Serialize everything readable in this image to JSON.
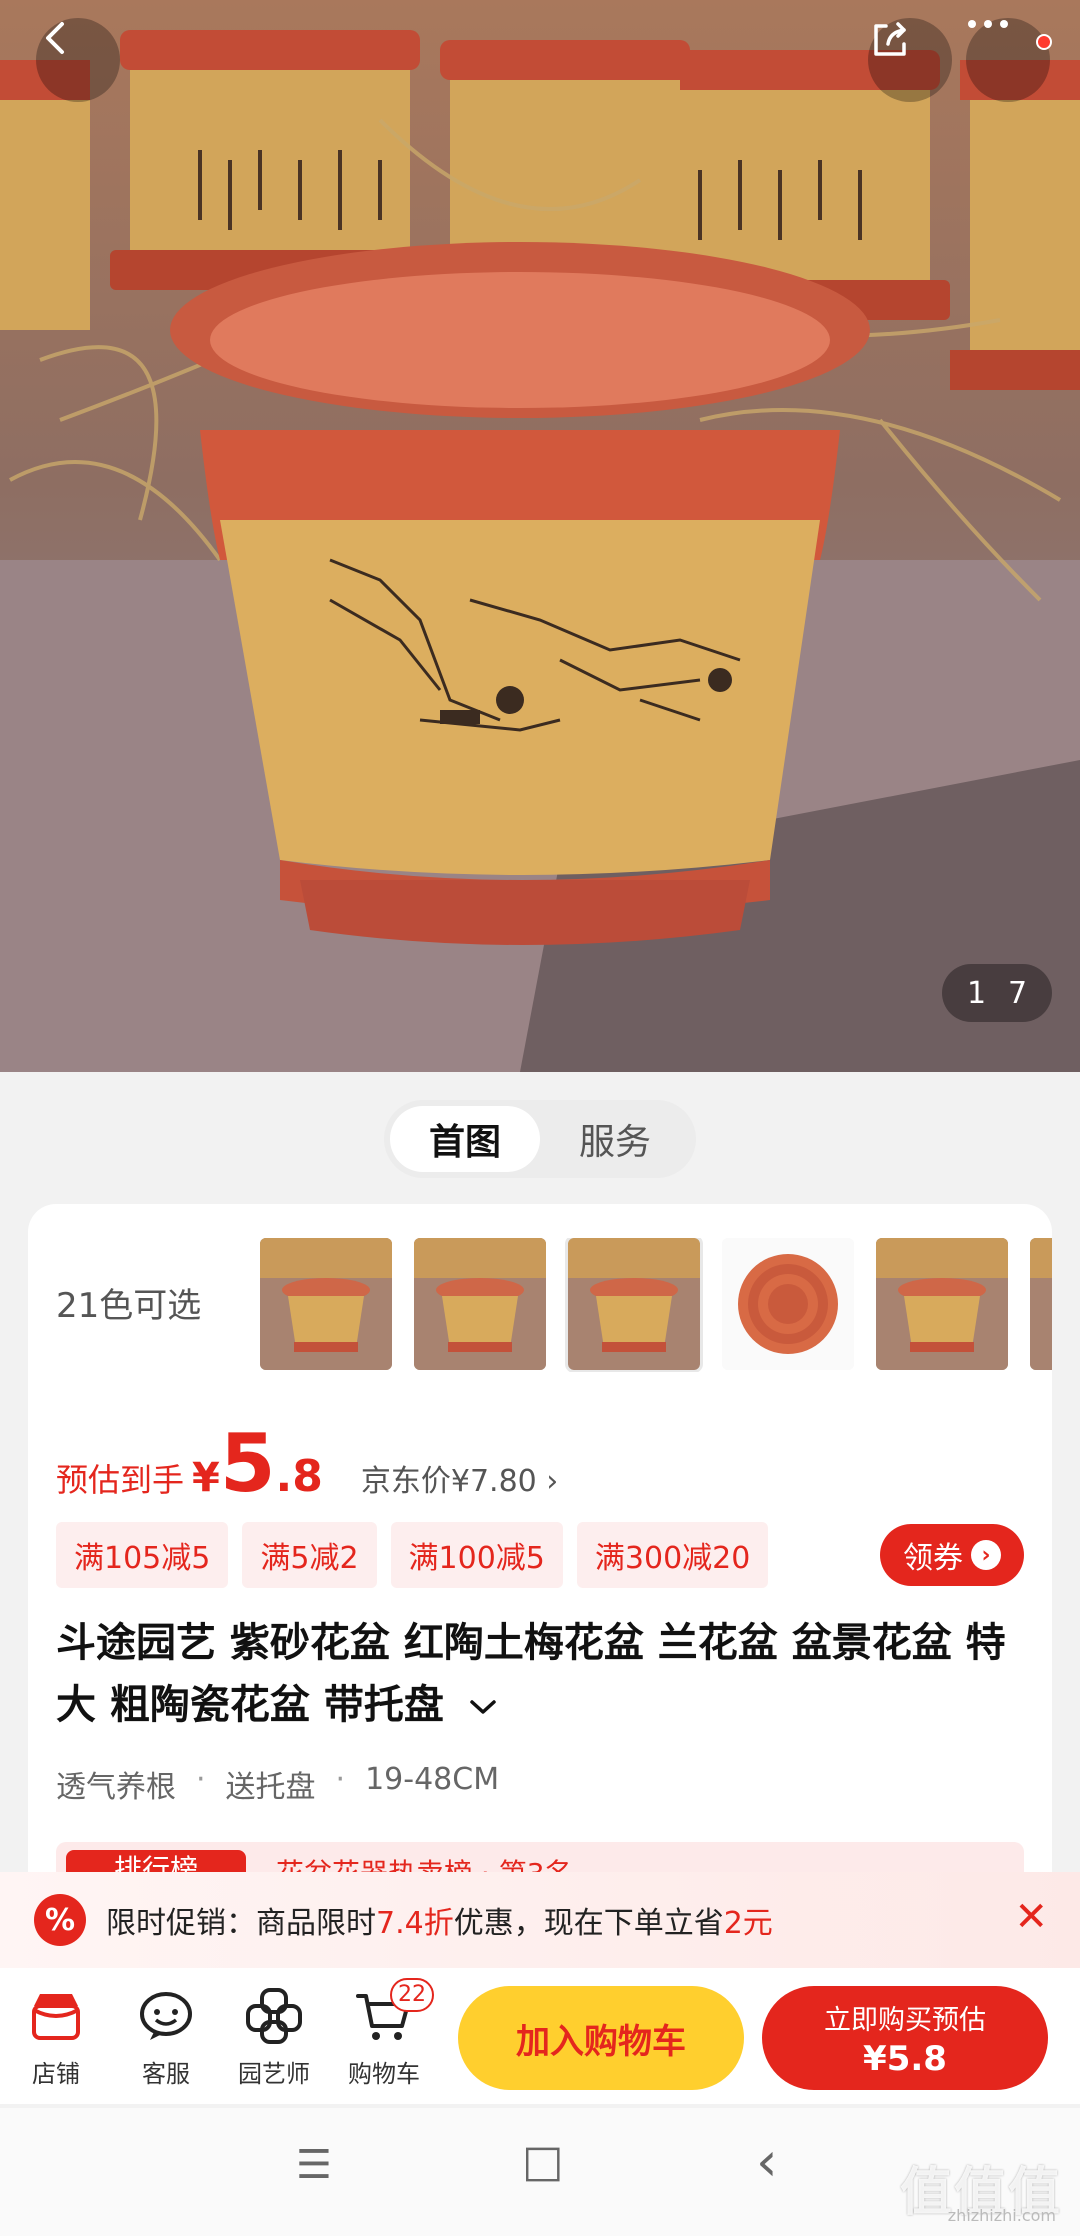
{
  "hero": {
    "counter_current": "1",
    "counter_total": "7"
  },
  "tabs": [
    {
      "label": "首图",
      "active": true
    },
    {
      "label": "服务",
      "active": false
    }
  ],
  "variants": {
    "count_label": "21色可选",
    "swatch_count_visible": 6
  },
  "price": {
    "prefix": "预估到手",
    "currency": "¥",
    "integer": "5",
    "decimal": ".8",
    "jd_price": "京东价¥7.80 ›"
  },
  "coupons": [
    "满105减5",
    "满5减2",
    "满100减5",
    "满300减20"
  ],
  "get_coupon_label": "领券",
  "product": {
    "title": "斗途园艺 紫砂花盆 红陶土梅花盆 兰花盆 盆景花盆 特大 粗陶瓷花盆 带托盘",
    "tags": [
      "透气养根",
      "送托盘",
      "19-48CM"
    ],
    "tag_separator": "·"
  },
  "rank": {
    "badge": "排行榜",
    "text": "花盆花器热卖榜 · 第3名"
  },
  "promo": {
    "icon": "%",
    "text_before": "限时促销：商品限时",
    "discount": "7.4折",
    "text_middle": "优惠，现在下单立省",
    "saving": "2元",
    "close": "✕"
  },
  "bottom_bar": {
    "items": [
      {
        "label": "店铺",
        "icon": "store-icon"
      },
      {
        "label": "客服",
        "icon": "customer-service-icon"
      },
      {
        "label": "园艺师",
        "icon": "gardener-icon"
      },
      {
        "label": "购物车",
        "icon": "cart-icon",
        "badge": "22"
      }
    ],
    "add_to_cart": "加入购物车",
    "buy_now_line1": "立即购买预估",
    "buy_now_line2": "¥5.8"
  },
  "system_nav": {
    "menu": "☰",
    "home": "□",
    "back": "‹"
  },
  "watermark": {
    "logo": "值值值",
    "site": "zhizhizhi.com"
  },
  "colors": {
    "accent_red": "#e4261d",
    "cart_yellow": "#ffcf2e"
  }
}
